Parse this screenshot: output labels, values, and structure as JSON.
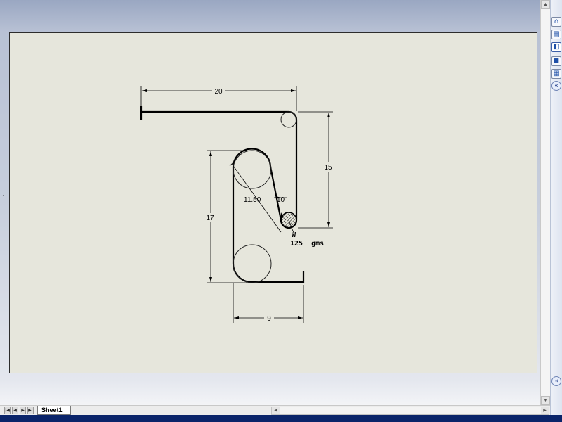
{
  "sheet_tab": {
    "label": "Sheet1"
  },
  "drawing": {
    "dimensions": {
      "top_width": "20",
      "right_height": "15",
      "left_height": "17",
      "bottom_width": "9",
      "diagonal_length": "11.50",
      "small_diameter": "10"
    },
    "weight_label": "W",
    "weight_value": "125  gms"
  },
  "side_panel": {
    "icons": [
      "home-icon",
      "library-icon",
      "file-explorer-icon",
      "view-palette-icon",
      "appearances-icon",
      "custom-properties-icon"
    ]
  },
  "navigation": {
    "first_symbol": "|◀",
    "prev_symbol": "◀",
    "next_symbol": "▶",
    "last_symbol": "▶|"
  }
}
